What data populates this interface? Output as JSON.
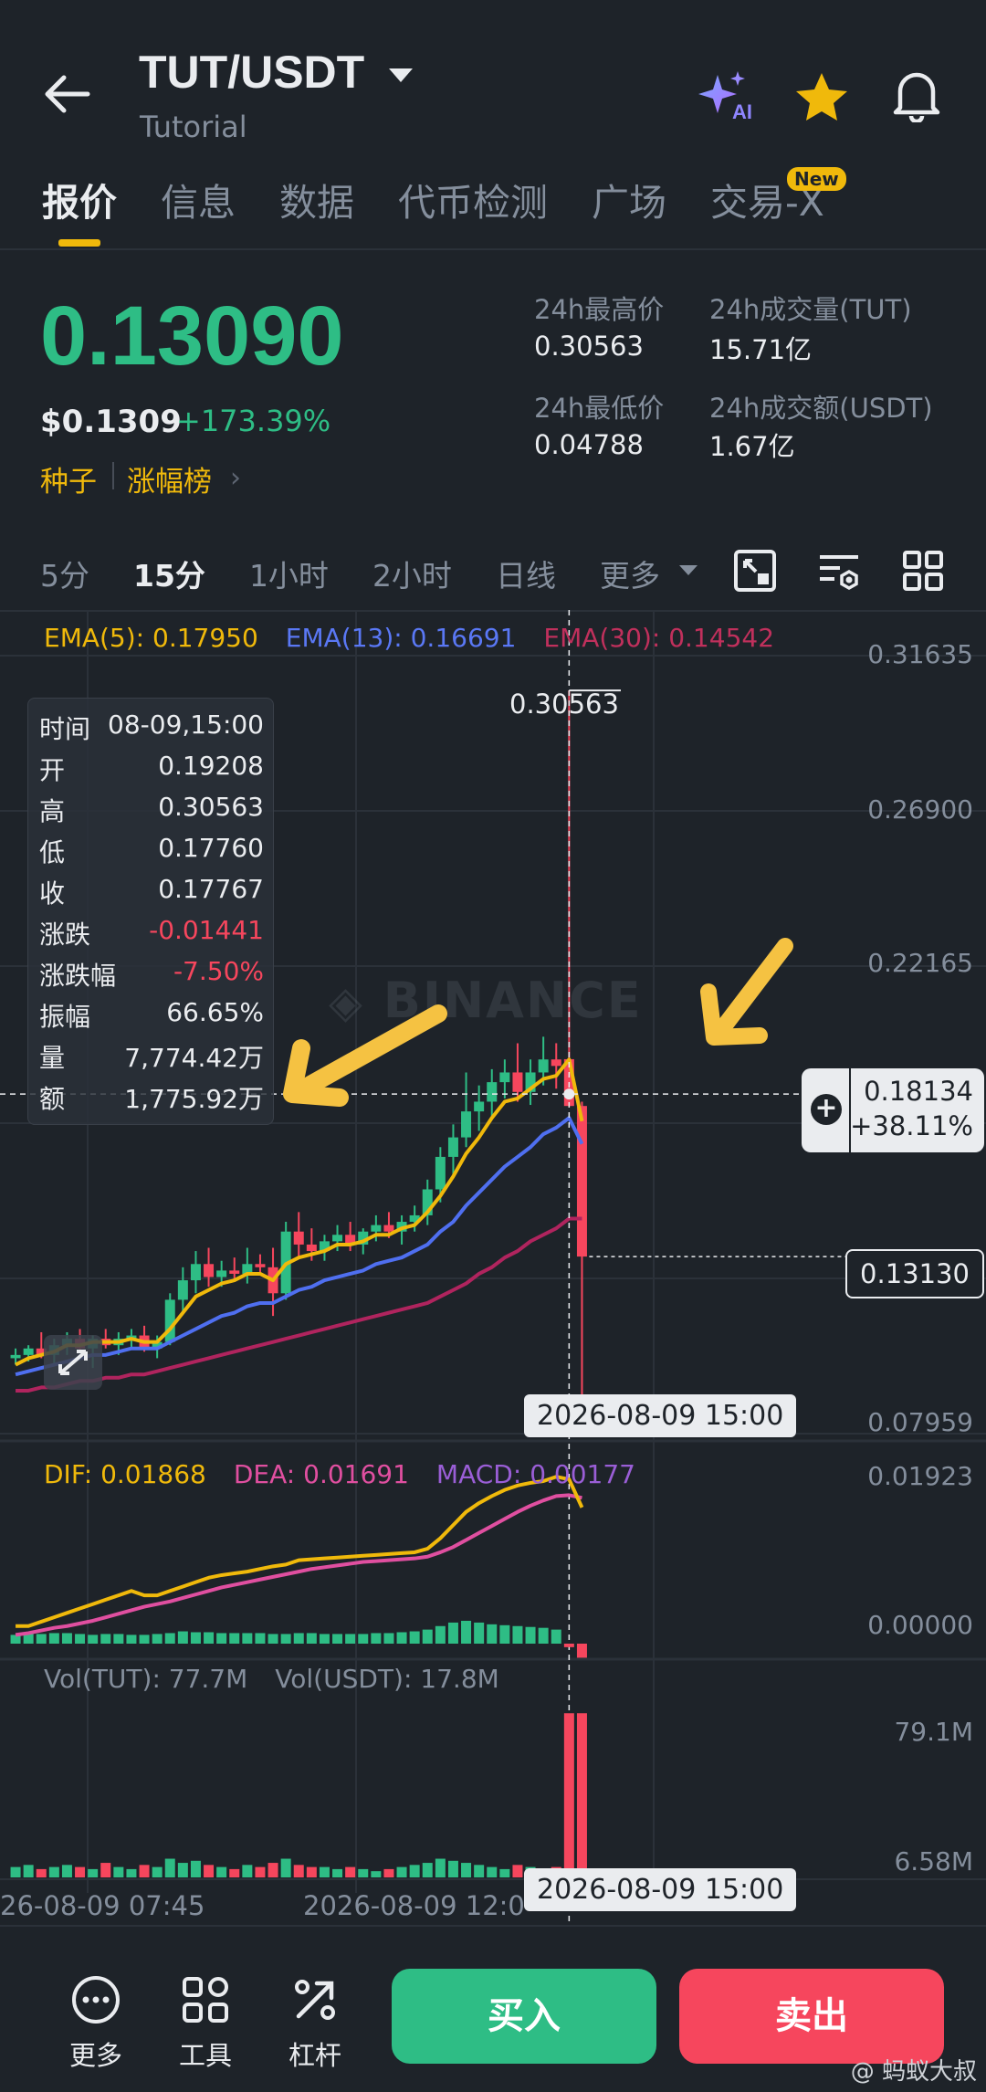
{
  "header": {
    "pair": "TUT/USDT",
    "subtitle": "Tutorial"
  },
  "tabs": [
    {
      "label": "报价"
    },
    {
      "label": "信息"
    },
    {
      "label": "数据"
    },
    {
      "label": "代币检测"
    },
    {
      "label": "广场"
    },
    {
      "label": "交易-X"
    }
  ],
  "new_badge": "New",
  "price": {
    "last": "0.13090",
    "usd": "$0.1309",
    "change_pct": "+173.39%",
    "tag1": "种子",
    "tag2": "涨幅榜"
  },
  "stats": {
    "high_label": "24h最高价",
    "high_value": "0.30563",
    "low_label": "24h最低价",
    "low_value": "0.04788",
    "vol_label": "24h成交量(TUT)",
    "vol_value": "15.71亿",
    "amt_label": "24h成交额(USDT)",
    "amt_value": "1.67亿"
  },
  "timeframes": [
    "5分",
    "15分",
    "1小时",
    "2小时",
    "日线",
    "更多"
  ],
  "ema": {
    "ema5": "EMA(5): 0.17950",
    "ema13": "EMA(13): 0.16691",
    "ema30": "EMA(30): 0.14542"
  },
  "price_axis": [
    "0.31635",
    "0.26900",
    "0.22165",
    "0.07959"
  ],
  "high_marker": "0.30563",
  "tooltip": [
    {
      "k": "时间",
      "v": "08-09,15:00"
    },
    {
      "k": "开",
      "v": "0.19208"
    },
    {
      "k": "高",
      "v": "0.30563"
    },
    {
      "k": "低",
      "v": "0.17760"
    },
    {
      "k": "收",
      "v": "0.17767"
    },
    {
      "k": "涨跌",
      "v": "-0.01441"
    },
    {
      "k": "涨跌幅",
      "v": "-7.50%"
    },
    {
      "k": "振幅",
      "v": "66.65%"
    },
    {
      "k": "量",
      "v": "7,774.42万"
    },
    {
      "k": "额",
      "v": "1,775.92万"
    }
  ],
  "crosshair_tag": {
    "price": "0.18134",
    "pct": "+38.11%"
  },
  "last_price_tag": "0.13130",
  "crosshair_time": "2026-08-09 15:00",
  "watermark_brand": "BINANCE",
  "macd": {
    "dif": "DIF: 0.01868",
    "dea": "DEA: 0.01691",
    "macd": "MACD: 0.00177",
    "axis_top": "0.01923",
    "axis_zero": "0.00000"
  },
  "volume": {
    "tut": "Vol(TUT): 77.7M",
    "usdt": "Vol(USDT): 17.8M",
    "axis_top": "79.1M",
    "axis_bottom": "6.58M"
  },
  "time_axis": [
    "26-08-09 07:45",
    "2026-08-09 12:0"
  ],
  "bottom": {
    "more": "更多",
    "tools": "工具",
    "leverage": "杠杆",
    "buy": "买入",
    "sell": "卖出",
    "watermark": "@ 蚂蚁大叔"
  },
  "colors": {
    "up": "#2ebd85",
    "down": "#f6465d",
    "accent": "#f0b90b",
    "ema5": "#f0b90b",
    "ema13": "#4f6ff0",
    "ema30": "#b0245e"
  },
  "chart_data": {
    "type": "candlestick",
    "ylim": [
      0.07959,
      0.31635
    ],
    "candles": [
      {
        "o": 0.1,
        "h": 0.103,
        "l": 0.098,
        "c": 0.101
      },
      {
        "o": 0.101,
        "h": 0.104,
        "l": 0.099,
        "c": 0.103
      },
      {
        "o": 0.103,
        "h": 0.108,
        "l": 0.1,
        "c": 0.101
      },
      {
        "o": 0.101,
        "h": 0.106,
        "l": 0.098,
        "c": 0.104
      },
      {
        "o": 0.104,
        "h": 0.108,
        "l": 0.101,
        "c": 0.106
      },
      {
        "o": 0.106,
        "h": 0.109,
        "l": 0.102,
        "c": 0.103
      },
      {
        "o": 0.103,
        "h": 0.107,
        "l": 0.097,
        "c": 0.106
      },
      {
        "o": 0.106,
        "h": 0.109,
        "l": 0.103,
        "c": 0.104
      },
      {
        "o": 0.104,
        "h": 0.108,
        "l": 0.101,
        "c": 0.106
      },
      {
        "o": 0.106,
        "h": 0.109,
        "l": 0.103,
        "c": 0.107
      },
      {
        "o": 0.107,
        "h": 0.11,
        "l": 0.102,
        "c": 0.103
      },
      {
        "o": 0.103,
        "h": 0.107,
        "l": 0.1,
        "c": 0.105
      },
      {
        "o": 0.105,
        "h": 0.12,
        "l": 0.104,
        "c": 0.118
      },
      {
        "o": 0.118,
        "h": 0.128,
        "l": 0.114,
        "c": 0.124
      },
      {
        "o": 0.124,
        "h": 0.133,
        "l": 0.12,
        "c": 0.129
      },
      {
        "o": 0.129,
        "h": 0.134,
        "l": 0.122,
        "c": 0.125
      },
      {
        "o": 0.125,
        "h": 0.13,
        "l": 0.122,
        "c": 0.127
      },
      {
        "o": 0.127,
        "h": 0.131,
        "l": 0.124,
        "c": 0.126
      },
      {
        "o": 0.126,
        "h": 0.134,
        "l": 0.123,
        "c": 0.129
      },
      {
        "o": 0.129,
        "h": 0.132,
        "l": 0.126,
        "c": 0.128
      },
      {
        "o": 0.128,
        "h": 0.134,
        "l": 0.113,
        "c": 0.12
      },
      {
        "o": 0.12,
        "h": 0.142,
        "l": 0.118,
        "c": 0.139
      },
      {
        "o": 0.139,
        "h": 0.145,
        "l": 0.131,
        "c": 0.135
      },
      {
        "o": 0.135,
        "h": 0.14,
        "l": 0.13,
        "c": 0.133
      },
      {
        "o": 0.133,
        "h": 0.138,
        "l": 0.13,
        "c": 0.136
      },
      {
        "o": 0.136,
        "h": 0.141,
        "l": 0.133,
        "c": 0.138
      },
      {
        "o": 0.138,
        "h": 0.142,
        "l": 0.133,
        "c": 0.135
      },
      {
        "o": 0.135,
        "h": 0.14,
        "l": 0.132,
        "c": 0.139
      },
      {
        "o": 0.139,
        "h": 0.144,
        "l": 0.136,
        "c": 0.141
      },
      {
        "o": 0.141,
        "h": 0.145,
        "l": 0.137,
        "c": 0.139
      },
      {
        "o": 0.139,
        "h": 0.144,
        "l": 0.135,
        "c": 0.142
      },
      {
        "o": 0.142,
        "h": 0.147,
        "l": 0.139,
        "c": 0.144
      },
      {
        "o": 0.144,
        "h": 0.155,
        "l": 0.141,
        "c": 0.152
      },
      {
        "o": 0.152,
        "h": 0.165,
        "l": 0.148,
        "c": 0.162
      },
      {
        "o": 0.162,
        "h": 0.172,
        "l": 0.156,
        "c": 0.168
      },
      {
        "o": 0.168,
        "h": 0.188,
        "l": 0.165,
        "c": 0.176
      },
      {
        "o": 0.176,
        "h": 0.184,
        "l": 0.17,
        "c": 0.179
      },
      {
        "o": 0.179,
        "h": 0.189,
        "l": 0.174,
        "c": 0.185
      },
      {
        "o": 0.185,
        "h": 0.192,
        "l": 0.18,
        "c": 0.188
      },
      {
        "o": 0.188,
        "h": 0.197,
        "l": 0.179,
        "c": 0.182
      },
      {
        "o": 0.182,
        "h": 0.192,
        "l": 0.178,
        "c": 0.188
      },
      {
        "o": 0.188,
        "h": 0.199,
        "l": 0.184,
        "c": 0.192
      },
      {
        "o": 0.192,
        "h": 0.197,
        "l": 0.183,
        "c": 0.19
      },
      {
        "o": 0.19208,
        "h": 0.30563,
        "l": 0.1776,
        "c": 0.17767
      },
      {
        "o": 0.17767,
        "h": 0.179,
        "l": 0.085,
        "c": 0.1313
      }
    ],
    "ema5": [
      0.098,
      0.1,
      0.101,
      0.102,
      0.104,
      0.104,
      0.105,
      0.105,
      0.105,
      0.106,
      0.105,
      0.105,
      0.109,
      0.114,
      0.119,
      0.121,
      0.123,
      0.124,
      0.126,
      0.126,
      0.124,
      0.129,
      0.131,
      0.132,
      0.133,
      0.135,
      0.135,
      0.136,
      0.138,
      0.138,
      0.14,
      0.141,
      0.145,
      0.15,
      0.156,
      0.163,
      0.168,
      0.174,
      0.179,
      0.18,
      0.183,
      0.186,
      0.187,
      0.192,
      0.173
    ],
    "ema13": [
      0.095,
      0.096,
      0.097,
      0.098,
      0.099,
      0.1,
      0.101,
      0.101,
      0.102,
      0.103,
      0.103,
      0.103,
      0.105,
      0.107,
      0.109,
      0.111,
      0.113,
      0.114,
      0.116,
      0.117,
      0.117,
      0.119,
      0.121,
      0.122,
      0.124,
      0.125,
      0.126,
      0.127,
      0.129,
      0.13,
      0.131,
      0.133,
      0.135,
      0.139,
      0.142,
      0.147,
      0.151,
      0.155,
      0.159,
      0.162,
      0.165,
      0.169,
      0.171,
      0.174,
      0.166
    ],
    "ema30": [
      0.09,
      0.09,
      0.091,
      0.091,
      0.092,
      0.093,
      0.093,
      0.094,
      0.094,
      0.095,
      0.095,
      0.096,
      0.097,
      0.098,
      0.099,
      0.1,
      0.101,
      0.102,
      0.103,
      0.104,
      0.105,
      0.106,
      0.107,
      0.108,
      0.109,
      0.11,
      0.111,
      0.112,
      0.113,
      0.114,
      0.115,
      0.116,
      0.117,
      0.119,
      0.121,
      0.123,
      0.126,
      0.128,
      0.131,
      0.133,
      0.136,
      0.138,
      0.14,
      0.143,
      0.143
    ],
    "volumes": [
      5,
      6,
      4,
      5,
      6,
      5,
      4,
      7,
      5,
      4,
      6,
      5,
      9,
      7,
      8,
      6,
      5,
      4,
      6,
      5,
      7,
      9,
      6,
      5,
      5,
      4,
      5,
      4,
      3,
      4,
      5,
      6,
      7,
      9,
      8,
      7,
      6,
      5,
      4,
      6,
      5,
      4,
      5,
      79,
      79
    ],
    "macd_hist": [
      0.001,
      0.0012,
      0.0011,
      0.0012,
      0.0012,
      0.0011,
      0.001,
      0.0011,
      0.0011,
      0.001,
      0.001,
      0.0011,
      0.0012,
      0.0014,
      0.0013,
      0.0013,
      0.0012,
      0.0012,
      0.0012,
      0.0012,
      0.0011,
      0.0011,
      0.0012,
      0.0012,
      0.0011,
      0.0011,
      0.0011,
      0.0011,
      0.0012,
      0.0012,
      0.0013,
      0.0014,
      0.0016,
      0.002,
      0.0024,
      0.0026,
      0.0024,
      0.0022,
      0.0021,
      0.002,
      0.0019,
      0.0018,
      0.0016,
      -0.0004,
      -0.0016
    ],
    "dif": [
      0.002,
      0.002,
      0.0025,
      0.003,
      0.0035,
      0.004,
      0.0045,
      0.005,
      0.0055,
      0.006,
      0.0055,
      0.0055,
      0.006,
      0.0065,
      0.007,
      0.0075,
      0.0078,
      0.008,
      0.0082,
      0.0085,
      0.0088,
      0.009,
      0.0095,
      0.0096,
      0.0097,
      0.0098,
      0.0099,
      0.01,
      0.0101,
      0.0102,
      0.0103,
      0.0104,
      0.0108,
      0.012,
      0.0135,
      0.015,
      0.016,
      0.0168,
      0.0175,
      0.018,
      0.0183,
      0.0185,
      0.019,
      0.0187,
      0.0155
    ],
    "dea": [
      0.001,
      0.0012,
      0.0015,
      0.0018,
      0.002,
      0.0023,
      0.0026,
      0.003,
      0.0034,
      0.0038,
      0.0042,
      0.0045,
      0.0048,
      0.0052,
      0.0056,
      0.006,
      0.0064,
      0.0067,
      0.007,
      0.0073,
      0.0076,
      0.0079,
      0.0082,
      0.0085,
      0.0087,
      0.0089,
      0.0091,
      0.0093,
      0.0094,
      0.0095,
      0.0096,
      0.0097,
      0.0099,
      0.0104,
      0.011,
      0.0118,
      0.0126,
      0.0134,
      0.0142,
      0.015,
      0.0157,
      0.0163,
      0.0168,
      0.0169,
      0.0166
    ]
  }
}
